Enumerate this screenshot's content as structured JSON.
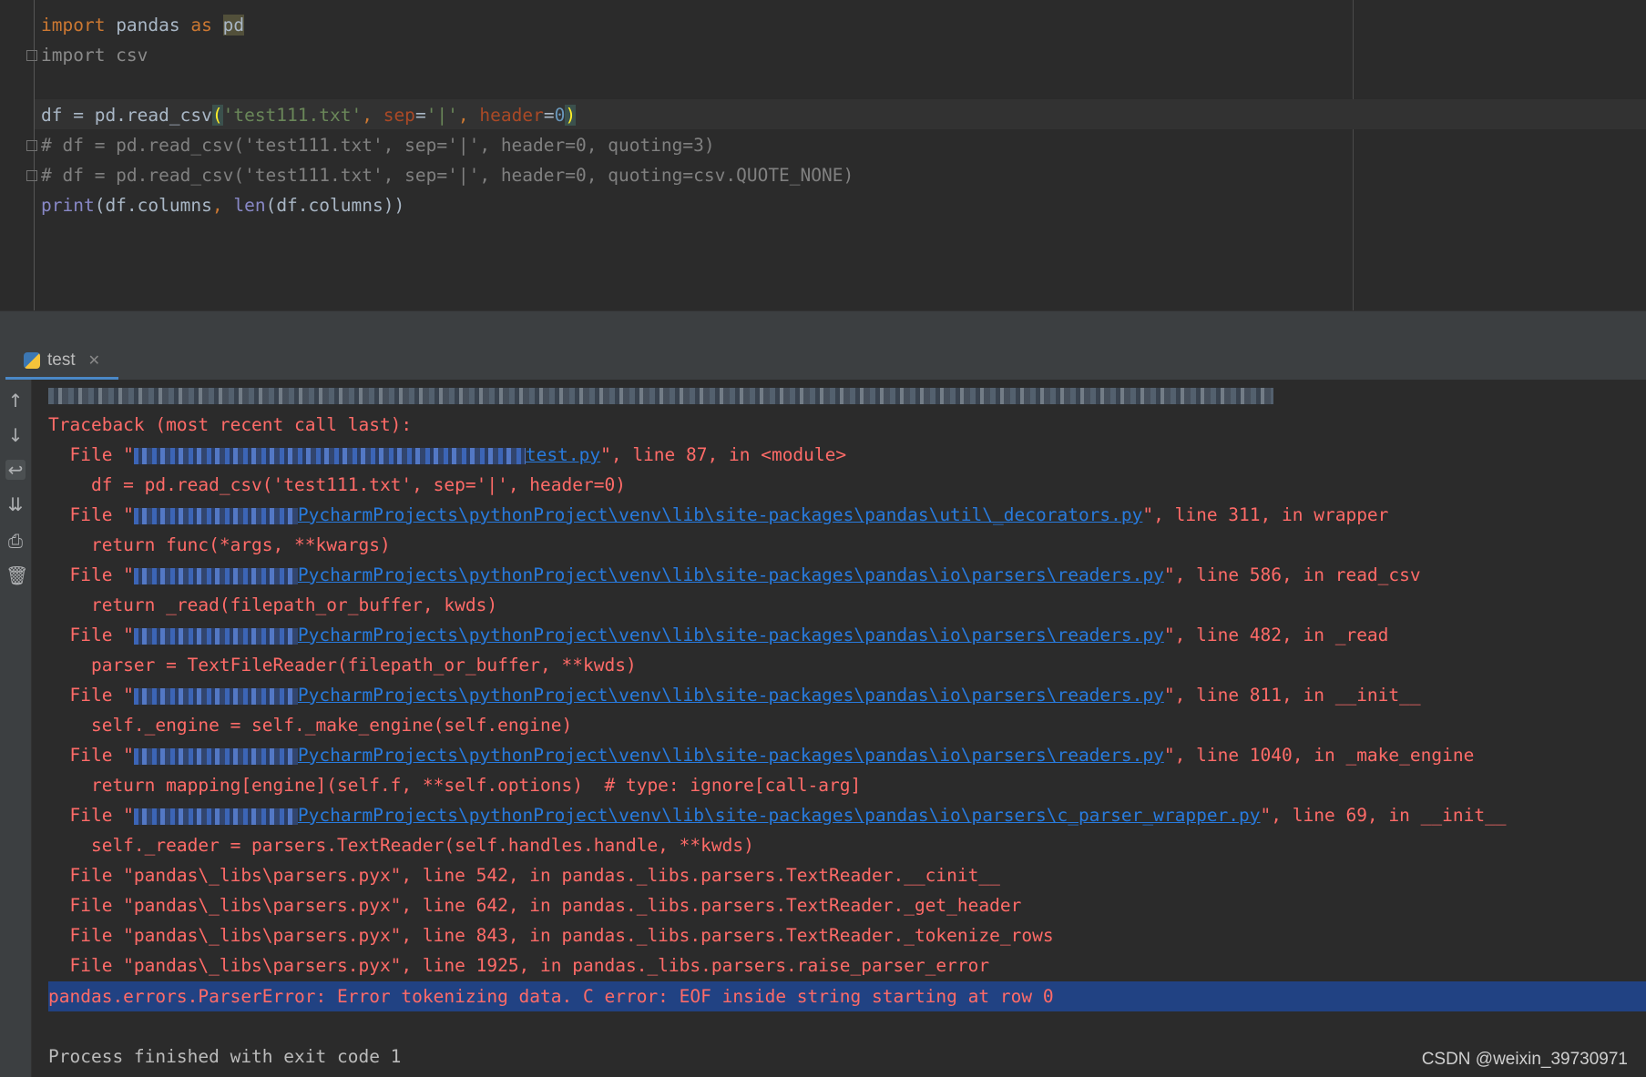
{
  "editor": {
    "line1": {
      "kw_import": "import",
      "module": " pandas ",
      "kw_as": "as",
      "alias": "pd"
    },
    "line2": {
      "text": "import csv"
    },
    "line4": {
      "a": "df = pd.read_csv",
      "lparen": "(",
      "s1": "'test111.txt'",
      "c1": ", ",
      "p_sep": "sep",
      "eq1": "=",
      "s2": "'|'",
      "c2": ", ",
      "p_header": "header",
      "eq2": "=",
      "n0": "0",
      "rparen": ")"
    },
    "line5": {
      "text": "# df = pd.read_csv('test111.txt', sep='|', header=0, quoting=3)"
    },
    "line6": {
      "text": "# df = pd.read_csv('test111.txt', sep='|', header=0, quoting=csv.QUOTE_NONE)"
    },
    "line7": {
      "print": "print",
      "a": "(df.columns",
      "comma": ",",
      "space": " ",
      "len": "len",
      "b": "(df.columns))"
    }
  },
  "run_tab": {
    "label": "test",
    "close": "✕"
  },
  "console": {
    "traceback": "Traceback (most recent call last):",
    "frames": [
      {
        "pre": "  File \"",
        "link": "test.py",
        "post": "\", line 87, in <module>",
        "code": "    df = pd.read_csv('test111.txt', sep='|', header=0)"
      },
      {
        "pre": "  File \"",
        "link": "PycharmProjects\\pythonProject\\venv\\lib\\site-packages\\pandas\\util\\_decorators.py",
        "post": "\", line 311, in wrapper",
        "code": "    return func(*args, **kwargs)"
      },
      {
        "pre": "  File \"",
        "link": "PycharmProjects\\pythonProject\\venv\\lib\\site-packages\\pandas\\io\\parsers\\readers.py",
        "post": "\", line 586, in read_csv",
        "code": "    return _read(filepath_or_buffer, kwds)"
      },
      {
        "pre": "  File \"",
        "link": "PycharmProjects\\pythonProject\\venv\\lib\\site-packages\\pandas\\io\\parsers\\readers.py",
        "post": "\", line 482, in _read",
        "code": "    parser = TextFileReader(filepath_or_buffer, **kwds)"
      },
      {
        "pre": "  File \"",
        "link": "PycharmProjects\\pythonProject\\venv\\lib\\site-packages\\pandas\\io\\parsers\\readers.py",
        "post": "\", line 811, in __init__",
        "code": "    self._engine = self._make_engine(self.engine)"
      },
      {
        "pre": "  File \"",
        "link": "PycharmProjects\\pythonProject\\venv\\lib\\site-packages\\pandas\\io\\parsers\\readers.py",
        "post": "\", line 1040, in _make_engine",
        "code": "    return mapping[engine](self.f, **self.options)  # type: ignore[call-arg]"
      },
      {
        "pre": "  File \"",
        "link": "PycharmProjects\\pythonProject\\venv\\lib\\site-packages\\pandas\\io\\parsers\\c_parser_wrapper.py",
        "post": "\", line 69, in __init__",
        "code": "    self._reader = parsers.TextReader(self.handles.handle, **kwds)"
      }
    ],
    "pyx_frames": [
      "  File \"pandas\\_libs\\parsers.pyx\", line 542, in pandas._libs.parsers.TextReader.__cinit__",
      "  File \"pandas\\_libs\\parsers.pyx\", line 642, in pandas._libs.parsers.TextReader._get_header",
      "  File \"pandas\\_libs\\parsers.pyx\", line 843, in pandas._libs.parsers.TextReader._tokenize_rows",
      "  File \"pandas\\_libs\\parsers.pyx\", line 1925, in pandas._libs.parsers.raise_parser_error"
    ],
    "error": "pandas.errors.ParserError: Error tokenizing data. C error: EOF inside string starting at row 0",
    "exit": "Process finished with exit code 1"
  },
  "watermark": "CSDN @weixin_39730971",
  "icons": [
    "up-arrow-icon",
    "down-arrow-icon",
    "soft-wrap-icon",
    "scroll-to-end-icon",
    "print-icon",
    "trash-icon",
    "python-file-icon"
  ]
}
